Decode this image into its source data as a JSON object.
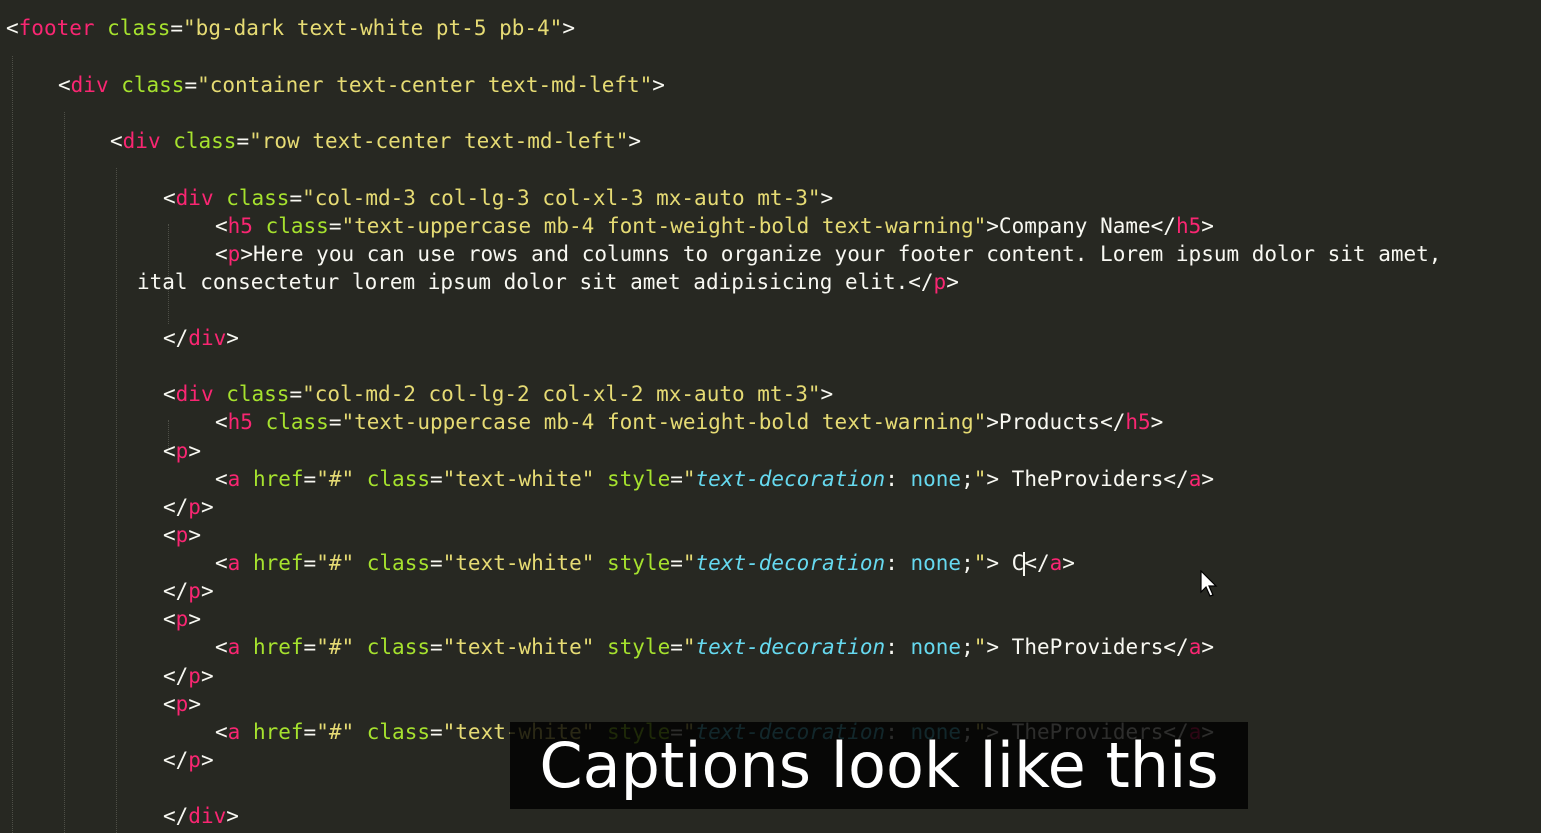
{
  "caption": "Captions look like this",
  "code": {
    "lines": [
      {
        "tokens": [
          [
            "p",
            "<"
          ],
          [
            "t",
            "footer"
          ],
          [
            "a",
            " class"
          ],
          [
            "p",
            "="
          ],
          [
            "s",
            "\"bg-dark text-white pt-5 pb-4\""
          ],
          [
            "p",
            ">"
          ]
        ]
      },
      {
        "tokens": [
          [
            "p",
            "<"
          ],
          [
            "t",
            "div"
          ],
          [
            "a",
            " class"
          ],
          [
            "p",
            "="
          ],
          [
            "s",
            "\"container text-center text-md-left\""
          ],
          [
            "p",
            ">"
          ]
        ]
      },
      {
        "tokens": [
          [
            "p",
            "<"
          ],
          [
            "t",
            "div"
          ],
          [
            "a",
            " class"
          ],
          [
            "p",
            "="
          ],
          [
            "s",
            "\"row text-center text-md-left\""
          ],
          [
            "p",
            ">"
          ]
        ]
      },
      {
        "tokens": [
          [
            "p",
            "<"
          ],
          [
            "t",
            "div"
          ],
          [
            "a",
            " class"
          ],
          [
            "p",
            "="
          ],
          [
            "s",
            "\"col-md-3 col-lg-3 col-xl-3 mx-auto mt-3\""
          ],
          [
            "p",
            ">"
          ]
        ]
      },
      {
        "tokens": [
          [
            "p",
            "<"
          ],
          [
            "t",
            "h5"
          ],
          [
            "a",
            " class"
          ],
          [
            "p",
            "="
          ],
          [
            "s",
            "\"text-uppercase mb-4 font-weight-bold text-warning\""
          ],
          [
            "p",
            ">"
          ],
          [
            "x",
            "Company Name"
          ],
          [
            "p",
            "</"
          ],
          [
            "t",
            "h5"
          ],
          [
            "p",
            ">"
          ]
        ]
      },
      {
        "tokens": [
          [
            "p",
            "<"
          ],
          [
            "t",
            "p"
          ],
          [
            "p",
            ">"
          ],
          [
            "x",
            "Here you can use rows and columns to organize your footer content. Lorem ipsum dolor sit amet,"
          ]
        ]
      },
      {
        "tokens": [
          [
            "x",
            "ital consectetur lorem ipsum dolor sit amet adipisicing elit."
          ],
          [
            "p",
            "</"
          ],
          [
            "t",
            "p"
          ],
          [
            "p",
            ">"
          ]
        ]
      },
      {
        "tokens": [
          [
            "p",
            "</"
          ],
          [
            "t",
            "div"
          ],
          [
            "p",
            ">"
          ]
        ]
      },
      {
        "tokens": [
          [
            "p",
            "<"
          ],
          [
            "t",
            "div"
          ],
          [
            "a",
            " class"
          ],
          [
            "p",
            "="
          ],
          [
            "s",
            "\"col-md-2 col-lg-2 col-xl-2 mx-auto mt-3\""
          ],
          [
            "p",
            ">"
          ]
        ]
      },
      {
        "tokens": [
          [
            "p",
            "<"
          ],
          [
            "t",
            "h5"
          ],
          [
            "a",
            " class"
          ],
          [
            "p",
            "="
          ],
          [
            "s",
            "\"text-uppercase mb-4 font-weight-bold text-warning\""
          ],
          [
            "p",
            ">"
          ],
          [
            "x",
            "Products"
          ],
          [
            "p",
            "</"
          ],
          [
            "t",
            "h5"
          ],
          [
            "p",
            ">"
          ]
        ]
      },
      {
        "tokens": [
          [
            "p",
            "<"
          ],
          [
            "t",
            "p"
          ],
          [
            "p",
            ">"
          ]
        ]
      },
      {
        "tokens": [
          [
            "p",
            "<"
          ],
          [
            "t",
            "a"
          ],
          [
            "a",
            " href"
          ],
          [
            "p",
            "="
          ],
          [
            "s",
            "\"#\""
          ],
          [
            "a",
            " class"
          ],
          [
            "p",
            "="
          ],
          [
            "s",
            "\"text-white\""
          ],
          [
            "a",
            " style"
          ],
          [
            "p",
            "="
          ],
          [
            "s",
            "\""
          ],
          [
            "c",
            "text-decoration"
          ],
          [
            "p",
            ": "
          ],
          [
            "k",
            "none"
          ],
          [
            "p",
            ";"
          ],
          [
            "s",
            "\""
          ],
          [
            "p",
            "> "
          ],
          [
            "x",
            "TheProviders"
          ],
          [
            "p",
            "</"
          ],
          [
            "t",
            "a"
          ],
          [
            "p",
            ">"
          ]
        ]
      },
      {
        "tokens": [
          [
            "p",
            "</"
          ],
          [
            "t",
            "p"
          ],
          [
            "p",
            ">"
          ]
        ]
      },
      {
        "tokens": [
          [
            "p",
            "<"
          ],
          [
            "t",
            "p"
          ],
          [
            "p",
            ">"
          ]
        ]
      },
      {
        "tokens": [
          [
            "p",
            "<"
          ],
          [
            "t",
            "a"
          ],
          [
            "a",
            " href"
          ],
          [
            "p",
            "="
          ],
          [
            "s",
            "\"#\""
          ],
          [
            "a",
            " class"
          ],
          [
            "p",
            "="
          ],
          [
            "s",
            "\"text-white\""
          ],
          [
            "a",
            " style"
          ],
          [
            "p",
            "="
          ],
          [
            "s",
            "\""
          ],
          [
            "c",
            "text-decoration"
          ],
          [
            "p",
            ": "
          ],
          [
            "k",
            "none"
          ],
          [
            "p",
            ";"
          ],
          [
            "s",
            "\""
          ],
          [
            "p",
            "> "
          ],
          [
            "x",
            "C"
          ],
          [
            "cursor",
            ""
          ],
          [
            "p",
            "</"
          ],
          [
            "t",
            "a"
          ],
          [
            "p",
            ">"
          ]
        ]
      },
      {
        "tokens": [
          [
            "p",
            "</"
          ],
          [
            "t",
            "p"
          ],
          [
            "p",
            ">"
          ]
        ]
      },
      {
        "tokens": [
          [
            "p",
            "<"
          ],
          [
            "t",
            "p"
          ],
          [
            "p",
            ">"
          ]
        ]
      },
      {
        "tokens": [
          [
            "p",
            "<"
          ],
          [
            "t",
            "a"
          ],
          [
            "a",
            " href"
          ],
          [
            "p",
            "="
          ],
          [
            "s",
            "\"#\""
          ],
          [
            "a",
            " class"
          ],
          [
            "p",
            "="
          ],
          [
            "s",
            "\"text-white\""
          ],
          [
            "a",
            " style"
          ],
          [
            "p",
            "="
          ],
          [
            "s",
            "\""
          ],
          [
            "c",
            "text-decoration"
          ],
          [
            "p",
            ": "
          ],
          [
            "k",
            "none"
          ],
          [
            "p",
            ";"
          ],
          [
            "s",
            "\""
          ],
          [
            "p",
            "> "
          ],
          [
            "x",
            "TheProviders"
          ],
          [
            "p",
            "</"
          ],
          [
            "t",
            "a"
          ],
          [
            "p",
            ">"
          ]
        ]
      },
      {
        "tokens": [
          [
            "p",
            "</"
          ],
          [
            "t",
            "p"
          ],
          [
            "p",
            ">"
          ]
        ]
      },
      {
        "tokens": [
          [
            "p",
            "<"
          ],
          [
            "t",
            "p"
          ],
          [
            "p",
            ">"
          ]
        ]
      },
      {
        "tokens": [
          [
            "p",
            "<"
          ],
          [
            "t",
            "a"
          ],
          [
            "a",
            " href"
          ],
          [
            "p",
            "="
          ],
          [
            "s",
            "\"#\""
          ],
          [
            "a",
            " class"
          ],
          [
            "p",
            "="
          ],
          [
            "s",
            "\"text-white\""
          ],
          [
            "a",
            " style"
          ],
          [
            "p",
            "="
          ],
          [
            "s",
            "\""
          ],
          [
            "c",
            "text-decoration"
          ],
          [
            "p",
            ": "
          ],
          [
            "k",
            "none"
          ],
          [
            "p",
            ";"
          ],
          [
            "s",
            "\""
          ],
          [
            "p",
            "> "
          ],
          [
            "x",
            "TheProviders"
          ],
          [
            "p",
            "</"
          ],
          [
            "t",
            "a"
          ],
          [
            "p",
            ">"
          ]
        ]
      },
      {
        "tokens": [
          [
            "p",
            "</"
          ],
          [
            "t",
            "p"
          ],
          [
            "p",
            ">"
          ]
        ]
      },
      {
        "tokens": [
          [
            "p",
            "</"
          ],
          [
            "t",
            "div"
          ],
          [
            "p",
            ">"
          ]
        ]
      }
    ]
  }
}
